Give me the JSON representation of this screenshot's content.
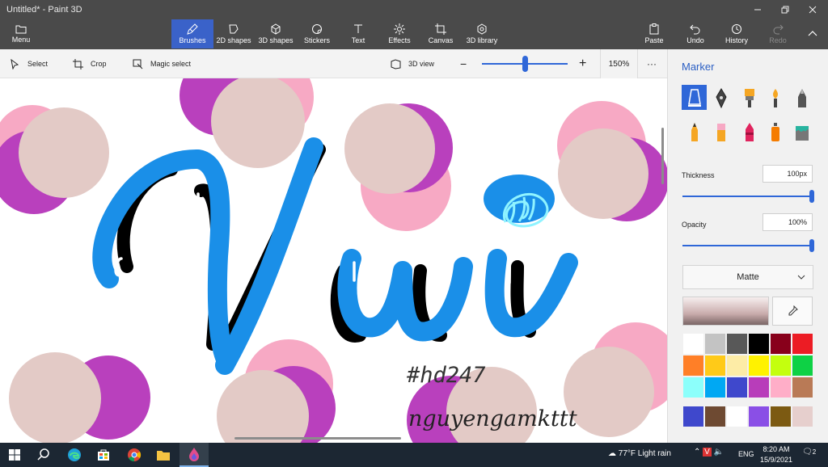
{
  "window": {
    "title": "Untitled* - Paint 3D",
    "minimize_icon": "minimize-icon",
    "maximize_icon": "restore-icon",
    "close_icon": "close-icon"
  },
  "ribbon": {
    "menu_label": "Menu",
    "tools": [
      {
        "label": "Brushes",
        "icon": "brush-icon",
        "active": true
      },
      {
        "label": "2D shapes",
        "icon": "2d-shapes-icon"
      },
      {
        "label": "3D shapes",
        "icon": "3d-shapes-icon"
      },
      {
        "label": "Stickers",
        "icon": "stickers-icon"
      },
      {
        "label": "Text",
        "icon": "text-icon"
      },
      {
        "label": "Effects",
        "icon": "effects-icon"
      },
      {
        "label": "Canvas",
        "icon": "canvas-icon"
      },
      {
        "label": "3D library",
        "icon": "3d-library-icon"
      }
    ],
    "right_tools": [
      {
        "label": "Paste",
        "icon": "paste-icon"
      },
      {
        "label": "Undo",
        "icon": "undo-icon"
      },
      {
        "label": "History",
        "icon": "history-icon"
      },
      {
        "label": "Redo",
        "icon": "redo-icon",
        "disabled": true
      }
    ]
  },
  "subbar": {
    "select_label": "Select",
    "crop_label": "Crop",
    "magic_select_label": "Magic select",
    "view3d_label": "3D view",
    "zoom_minus": "−",
    "zoom_plus": "+",
    "zoom_value": "150%",
    "zoom_level": 0.5,
    "more_label": "···"
  },
  "canvas": {
    "hashtag": "#hd247",
    "signature": "nguyengamkttt"
  },
  "panel": {
    "title": "Marker",
    "brushes": [
      "marker",
      "calligraphy-pen",
      "oil-brush",
      "watercolor",
      "pixel-pen",
      "pencil",
      "eraser",
      "crayon",
      "spray-can",
      "fill"
    ],
    "selected_brush": "marker",
    "thickness_label": "Thickness",
    "thickness_value": "100px",
    "opacity_label": "Opacity",
    "opacity_value": "100%",
    "finish_value": "Matte",
    "colors_row": [
      "#ffffff",
      "#c3c3c3",
      "#585858",
      "#000000",
      "#88001b",
      "#ec1c24",
      "#ff7f27",
      "#ffca18",
      "#fdeca6",
      "#fff200",
      "#c4ff0e",
      "#0ed145",
      "#8cfffb",
      "#00a8f3",
      "#3f48cc",
      "#b83dba",
      "#ffaec8",
      "#b97a56"
    ],
    "custom_colors": [
      "#3f48cc",
      "#6e4a32",
      "#ffffff",
      "#8a4fe6",
      "#7c5a12",
      "#e6cfcd"
    ]
  },
  "taskbar": {
    "weather": "77°F  Light rain",
    "lang": "ENG",
    "time": "8:20 AM",
    "date": "15/9/2021",
    "notifications": "2"
  }
}
